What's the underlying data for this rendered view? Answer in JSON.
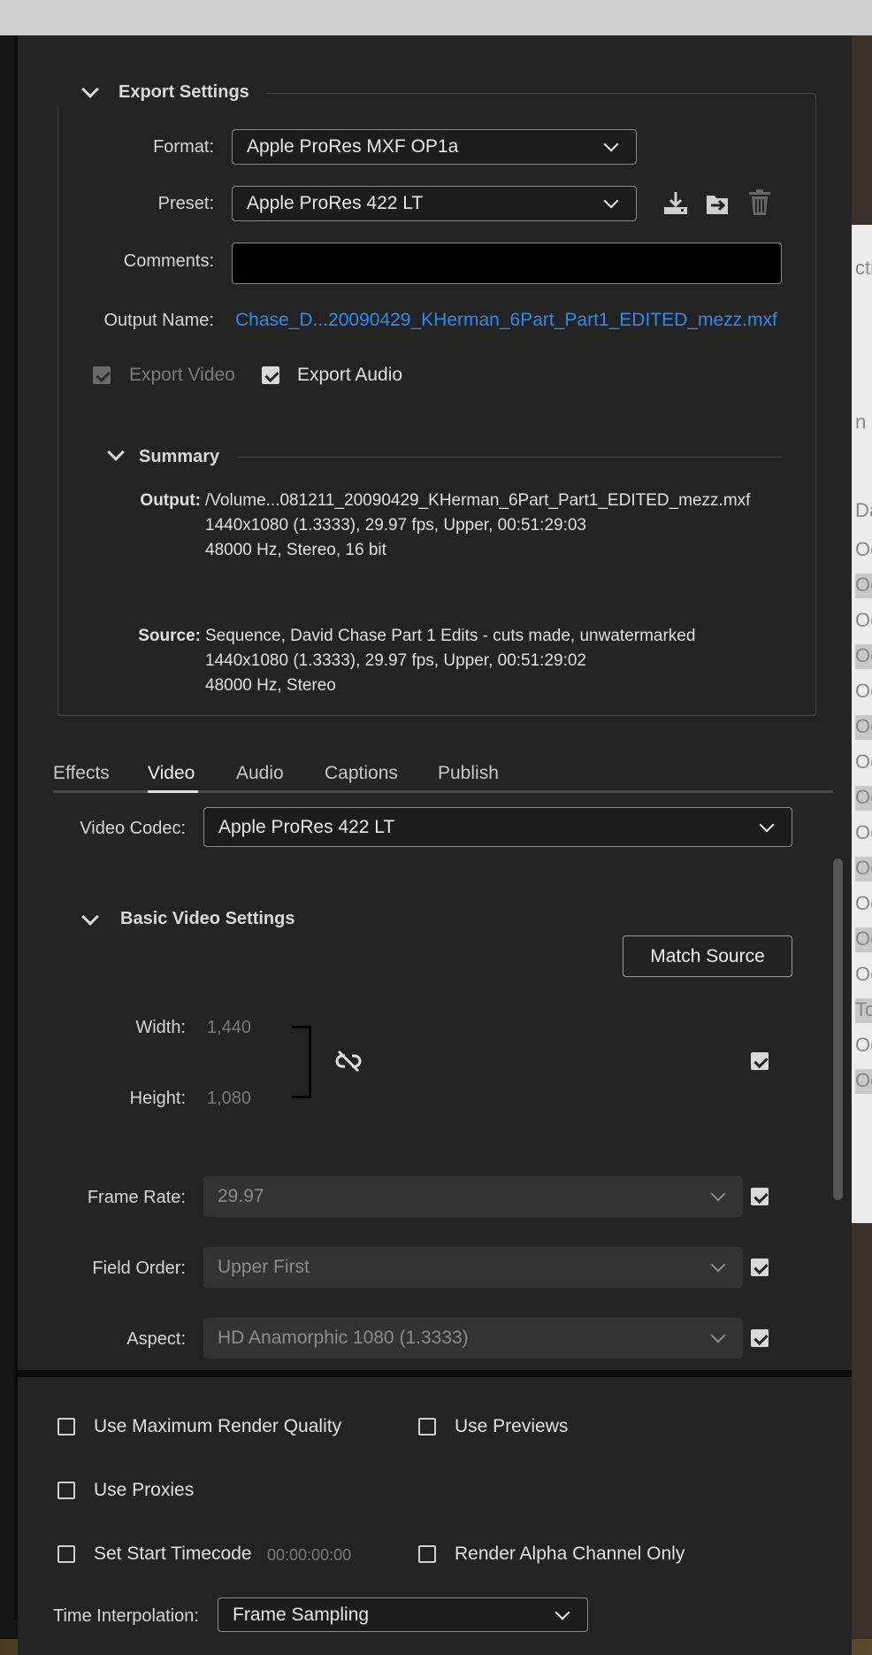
{
  "export_settings": {
    "title": "Export Settings",
    "format": {
      "label": "Format:",
      "value": "Apple ProRes MXF OP1a"
    },
    "preset": {
      "label": "Preset:",
      "value": "Apple ProRes 422 LT"
    },
    "comments": {
      "label": "Comments:",
      "value": ""
    },
    "output_name": {
      "label": "Output Name:",
      "value": "Chase_D...20090429_KHerman_6Part_Part1_EDITED_mezz.mxf"
    },
    "export_video": {
      "label": "Export Video",
      "checked": true,
      "enabled": false
    },
    "export_audio": {
      "label": "Export Audio",
      "checked": true
    }
  },
  "summary": {
    "title": "Summary",
    "output_label": "Output:",
    "output_lines": [
      "/Volume...081211_20090429_KHerman_6Part_Part1_EDITED_mezz.mxf",
      "1440x1080 (1.3333), 29.97 fps, Upper, 00:51:29:03",
      "48000 Hz, Stereo, 16 bit"
    ],
    "source_label": "Source:",
    "source_lines": [
      "Sequence, David Chase Part 1 Edits - cuts made, unwatermarked",
      "1440x1080 (1.3333), 29.97 fps, Upper, 00:51:29:02",
      "48000 Hz, Stereo"
    ]
  },
  "tabs": [
    {
      "label": "Effects",
      "active": false
    },
    {
      "label": "Video",
      "active": true
    },
    {
      "label": "Audio",
      "active": false
    },
    {
      "label": "Captions",
      "active": false
    },
    {
      "label": "Publish",
      "active": false
    }
  ],
  "video": {
    "codec": {
      "label": "Video Codec:",
      "value": "Apple ProRes 422 LT"
    },
    "basic_title": "Basic Video Settings",
    "match_source_label": "Match Source",
    "width": {
      "label": "Width:",
      "value": "1,440"
    },
    "height": {
      "label": "Height:",
      "value": "1,080"
    },
    "frame_rate": {
      "label": "Frame Rate:",
      "value": "29.97"
    },
    "field_order": {
      "label": "Field Order:",
      "value": "Upper First"
    },
    "aspect": {
      "label": "Aspect:",
      "value": "HD Anamorphic 1080 (1.3333)"
    }
  },
  "bottom": {
    "max_render_quality": "Use Maximum Render Quality",
    "use_previews": "Use Previews",
    "use_proxies": "Use Proxies",
    "set_start_timecode": "Set Start Timecode",
    "timecode_value": "00:00:00:00",
    "render_alpha": "Render Alpha Channel Only",
    "time_interpolation": {
      "label": "Time Interpolation:",
      "value": "Frame Sampling"
    }
  },
  "background_list": {
    "rows": [
      "Oc",
      "Oc",
      "Oc",
      "Oc",
      "Oc",
      "Oc",
      "Oc",
      "Oc",
      "Oc",
      "Oc",
      "Oc",
      "Oc",
      "Oc",
      "Too",
      "Oc",
      "Oc"
    ],
    "header": "Dat",
    "partial_1": "ctio",
    "partial_2": "n"
  },
  "colors": {
    "accent_link": "#2d8ceb",
    "panel_bg": "#232323"
  }
}
